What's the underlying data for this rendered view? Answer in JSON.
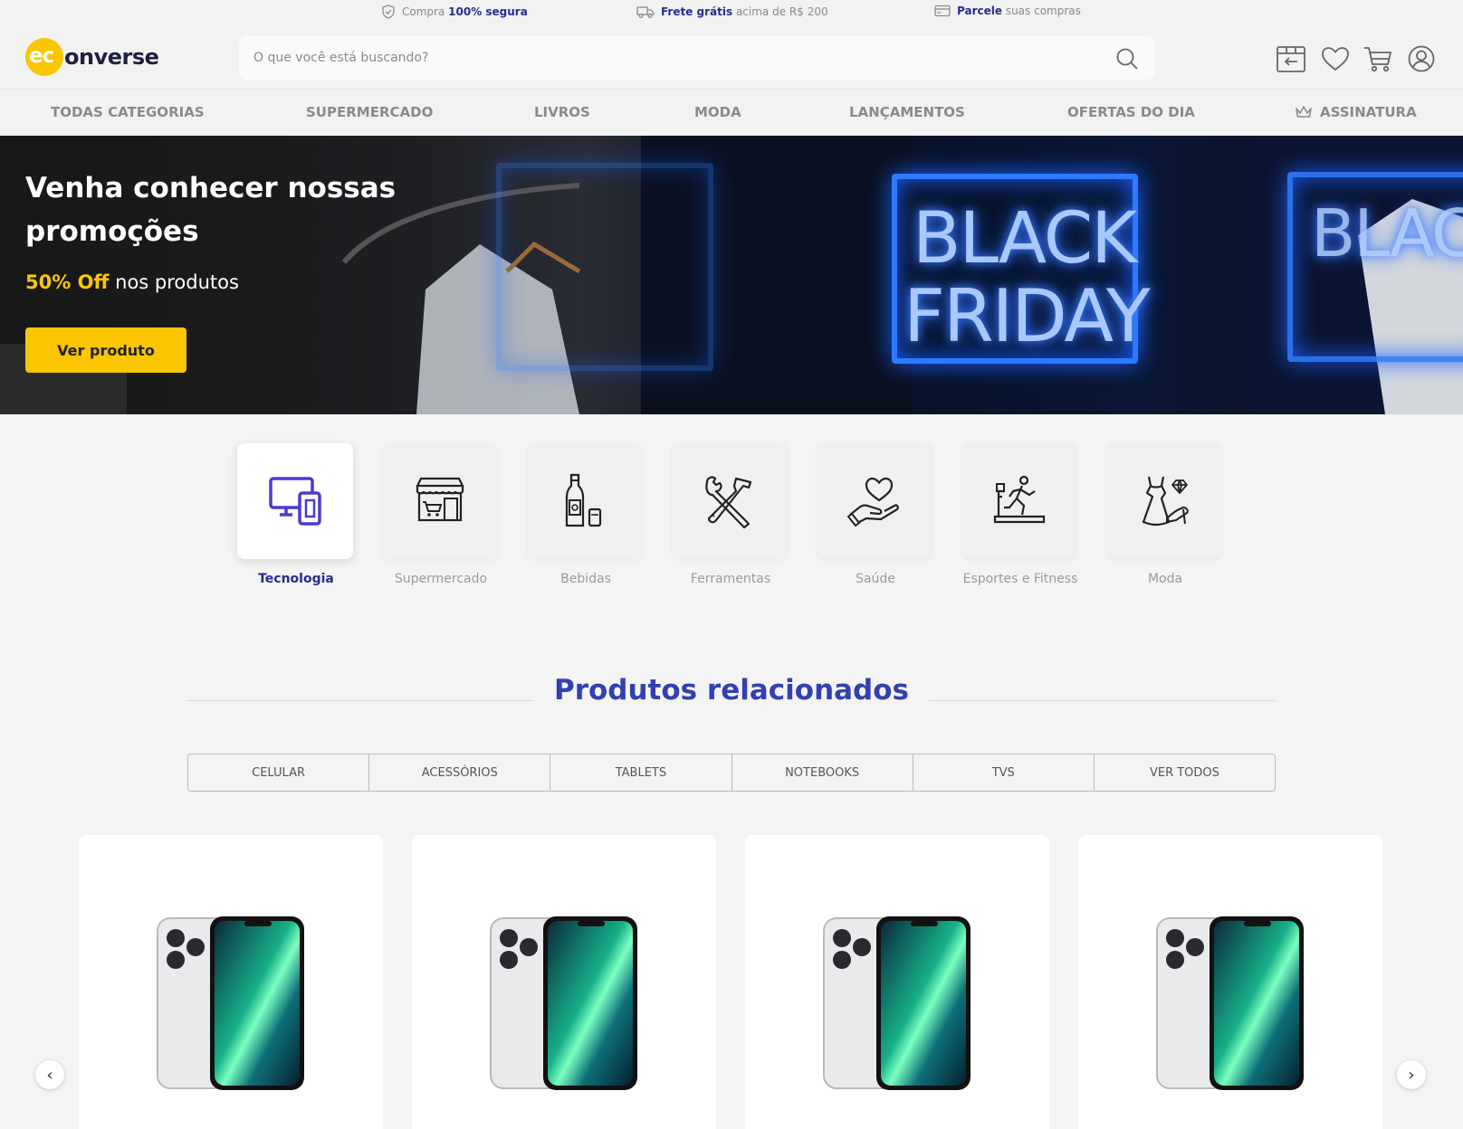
{
  "topbar": {
    "secure": {
      "pre": "Compra ",
      "bold": "100% segura",
      "post": ""
    },
    "shipping": {
      "pre": "",
      "bold": "Frete grátis",
      "post": " acima de R$ 200"
    },
    "installments": {
      "pre": "",
      "bold": "Parcele",
      "post": " suas compras"
    }
  },
  "header": {
    "logo_ec": "ec",
    "logo_rest": "onverse",
    "search_placeholder": "O que você está buscando?"
  },
  "nav": {
    "items": [
      "TODAS CATEGORIAS",
      "SUPERMERCADO",
      "LIVROS",
      "MODA",
      "LANÇAMENTOS",
      "OFERTAS DO DIA",
      "ASSINATURA"
    ]
  },
  "hero": {
    "title": "Venha conhecer nossas promoções",
    "sub_highlight": "50% Off",
    "sub_rest": " nos produtos",
    "button": "Ver produto",
    "sign_line1": "BLACK",
    "sign_line2": "FRIDAY"
  },
  "categories": [
    {
      "label": "Tecnologia",
      "icon": "devices-icon",
      "active": true
    },
    {
      "label": "Supermercado",
      "icon": "store-icon",
      "active": false
    },
    {
      "label": "Bebidas",
      "icon": "bottle-icon",
      "active": false
    },
    {
      "label": "Ferramentas",
      "icon": "tools-icon",
      "active": false
    },
    {
      "label": "Saúde",
      "icon": "heart-hand-icon",
      "active": false
    },
    {
      "label": "Esportes e Fitness",
      "icon": "treadmill-icon",
      "active": false
    },
    {
      "label": "Moda",
      "icon": "dress-icon",
      "active": false
    }
  ],
  "section": {
    "title": "Produtos relacionados"
  },
  "tabs": [
    "CELULAR",
    "ACESSÓRIOS",
    "TABLETS",
    "NOTEBOOKS",
    "TVS",
    "VER TODOS"
  ],
  "carousel": {
    "prev": "‹",
    "next": "›"
  },
  "colors": {
    "brand_yellow": "#f9c600",
    "brand_blue": "#2a2a8e",
    "title_blue": "#3340b0"
  }
}
